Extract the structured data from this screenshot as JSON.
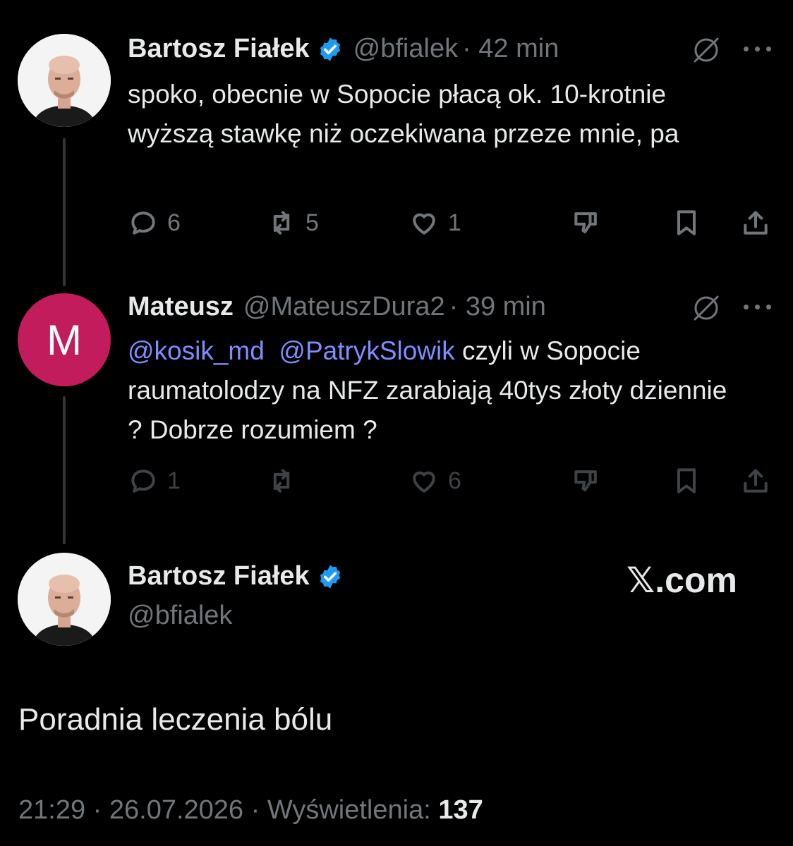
{
  "reply1": {
    "name": "Bartosz Fiałek",
    "handle": "@bfialek",
    "time": "· 42 min",
    "text": "spoko, obecnie w Sopocie płacą ok. 10-krotnie wyższą stawkę niż oczekiwana przeze mnie, pa",
    "replies": "6",
    "reposts": "5",
    "likes": "1"
  },
  "reply2": {
    "name": "Mateusz",
    "handle": "@MateuszDura2",
    "time": "· 39 min",
    "avatar_letter": "M",
    "mention1": "@kosik_md",
    "mention2": "@PatrykSlowik",
    "text": " czyli w Sopocie raumatolodzy na NFZ zarabiają 40tys złoty dziennie ?  Dobrze rozumiem ?",
    "replies": "1",
    "likes": "6"
  },
  "main": {
    "name": "Bartosz Fiałek",
    "handle": "@bfialek",
    "watermark": "𝕏.com",
    "text": "Poradnia leczenia bólu",
    "timestamp": "21:29 · 26.07.2026 · Wyświetlenia: ",
    "views": "137"
  },
  "colors": {
    "background": "#000000",
    "text": "#e7e9ea",
    "muted": "#71767b",
    "mention": "#7d8cff",
    "verified": "#1d9bf0",
    "avatar_m": "#c21c5c"
  },
  "icons": [
    "reply-icon",
    "repost-icon",
    "like-icon",
    "dislike-icon",
    "bookmark-icon",
    "share-icon",
    "grok-icon",
    "more-icon",
    "verified-icon"
  ]
}
